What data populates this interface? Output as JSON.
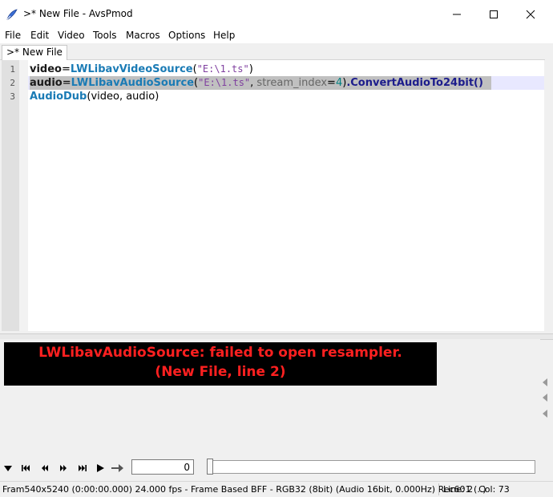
{
  "window": {
    "title": ">* New File - AvsPmod",
    "icons": {
      "app": "avspmod-quill-icon",
      "minimize": "minimize-icon",
      "maximize": "maximize-icon",
      "close": "close-icon"
    }
  },
  "menu": [
    "File",
    "Edit",
    "Video",
    "Tools",
    "Macros",
    "Options",
    "Help"
  ],
  "tabs": [
    {
      "label": ">* New File"
    }
  ],
  "editor": {
    "line_numbers": [
      "1",
      "2",
      "3"
    ],
    "lines": [
      {
        "var": "video",
        "eq": "=",
        "func": "LWLibavVideoSource",
        "open": "(",
        "str": "\"E:\\1.ts\"",
        "close": ")"
      },
      {
        "var": "audio",
        "eq": "=",
        "func": "LWLibavAudioSource",
        "open": "(",
        "str": "\"E:\\1.ts\"",
        "comma": ", ",
        "argname": "stream_index",
        "argeq": "=",
        "argval": "4",
        "close": ")",
        "method": ".ConvertAudioTo24bit()"
      },
      {
        "func": "AudioDub",
        "args": "(video, audio)"
      }
    ],
    "colors": {
      "keyword": "#1a1a1a",
      "function": "#1a7bb5",
      "string": "#7f3f9f",
      "number": "#008080",
      "selection": "#c0c0c0"
    }
  },
  "preview": {
    "error_line1": "LWLibavAudioSource: failed to open resampler.",
    "error_line2": "(New File, line 2)",
    "error_color": "#ff2020"
  },
  "toolbar": {
    "buttons": [
      "triangle-down-icon",
      "skip-to-start-icon",
      "step-back-icon",
      "step-forward-icon",
      "skip-to-end-icon",
      "play-icon",
      "external-player-icon"
    ],
    "frame_value": "0",
    "slider_position": 0
  },
  "status": {
    "main": "Fram540x5240 (0:00:00.000) 24.000 fps - Frame Based BFF - RGB32 (8bit) (Audio 16bit, 0.000Hz) Rec601 (..)",
    "line": "Line: 2",
    "col": "Col: 73"
  }
}
